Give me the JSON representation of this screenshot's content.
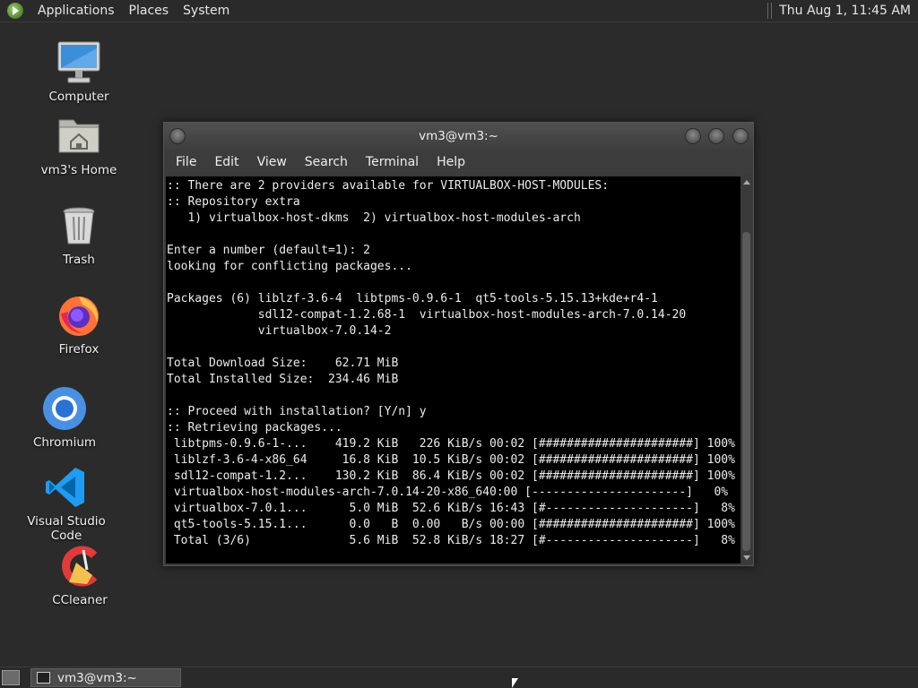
{
  "top_panel": {
    "menus": [
      "Applications",
      "Places",
      "System"
    ],
    "clock": "Thu Aug  1, 11:45 AM"
  },
  "desktop_icons": [
    {
      "label": "Computer",
      "icon": "computer-icon"
    },
    {
      "label": "vm3's Home",
      "icon": "home-folder-icon"
    },
    {
      "label": "Trash",
      "icon": "trash-icon"
    },
    {
      "label": "Firefox",
      "icon": "firefox-icon"
    },
    {
      "label": "Chromium",
      "icon": "chromium-icon"
    },
    {
      "label": "Visual Studio Code",
      "icon": "vscode-icon"
    },
    {
      "label": "CCleaner",
      "icon": "ccleaner-icon"
    }
  ],
  "terminal": {
    "title": "vm3@vm3:~",
    "menu": [
      "File",
      "Edit",
      "View",
      "Search",
      "Terminal",
      "Help"
    ],
    "lines": [
      ":: There are 2 providers available for VIRTUALBOX-HOST-MODULES:",
      ":: Repository extra",
      "   1) virtualbox-host-dkms  2) virtualbox-host-modules-arch",
      "",
      "Enter a number (default=1): 2",
      "looking for conflicting packages...",
      "",
      "Packages (6) liblzf-3.6-4  libtpms-0.9.6-1  qt5-tools-5.15.13+kde+r4-1",
      "             sdl12-compat-1.2.68-1  virtualbox-host-modules-arch-7.0.14-20",
      "             virtualbox-7.0.14-2",
      "",
      "Total Download Size:    62.71 MiB",
      "Total Installed Size:  234.46 MiB",
      "",
      ":: Proceed with installation? [Y/n] y",
      ":: Retrieving packages...",
      " libtpms-0.9.6-1-...    419.2 KiB   226 KiB/s 00:02 [######################] 100%",
      " liblzf-3.6-4-x86_64     16.8 KiB  10.5 KiB/s 00:02 [######################] 100%",
      " sdl12-compat-1.2...    130.2 KiB  86.4 KiB/s 00:02 [######################] 100%",
      " virtualbox-host-modules-arch-7.0.14-20-x86_640:00 [----------------------]   0%",
      " virtualbox-7.0.1...      5.0 MiB  52.6 KiB/s 16:43 [#---------------------]   8%",
      " qt5-tools-5.15.1...      0.0   B  0.00   B/s 00:00 [######################] 100%",
      " Total (3/6)              5.6 MiB  52.8 KiB/s 18:27 [#---------------------]   8%"
    ]
  },
  "taskbar": {
    "task_label": "vm3@vm3:~"
  }
}
